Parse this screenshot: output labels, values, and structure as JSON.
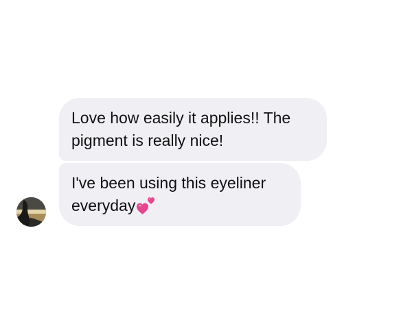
{
  "thread": {
    "messages": [
      {
        "lines": [
          "Love how easily it applies!! The",
          "pigment is really nice!"
        ]
      },
      {
        "lines": [
          "I've been using this eyeliner",
          "everyday"
        ],
        "emoji": "two-hearts-icon"
      }
    ]
  },
  "colors": {
    "bubble_background": "#efeff4",
    "text": "#111111",
    "emoji_heart": "#e8458e"
  }
}
